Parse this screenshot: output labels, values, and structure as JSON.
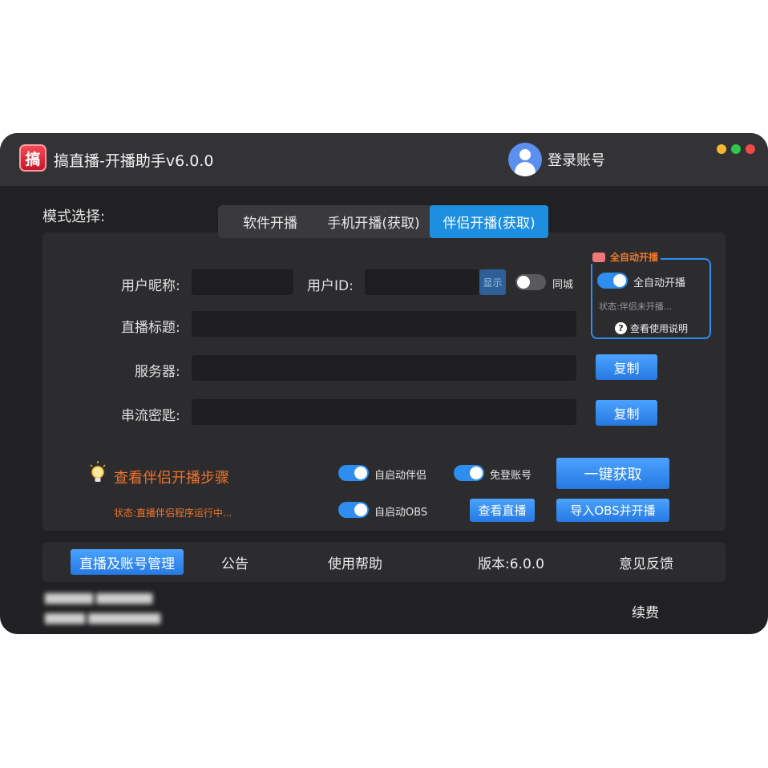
{
  "app": {
    "logo_char": "搞",
    "title": "搞直播-开播助手v6.0.0",
    "login_label": "登录账号",
    "window_dots": [
      "#f5b82e",
      "#2fc84a",
      "#ee4a4a"
    ]
  },
  "mode": {
    "label": "模式选择:",
    "tabs": [
      {
        "label": "软件开播",
        "active": false
      },
      {
        "label": "手机开播(获取)",
        "active": false
      },
      {
        "label": "伴侣开播(获取)",
        "active": true
      }
    ]
  },
  "form": {
    "nickname_label": "用户昵称:",
    "nickname_value": "",
    "userid_label": "用户ID:",
    "userid_value": "",
    "show_button": "显示",
    "same_city_label": "同城",
    "same_city_on": false,
    "title_label": "直播标题:",
    "title_value": "",
    "server_label": "服务器:",
    "server_value": "",
    "key_label": "串流密匙:",
    "key_value": "",
    "copy_label": "复制"
  },
  "auto_start": {
    "title": "全自动开播",
    "toggle_label": "全自动开播",
    "toggle_on": true,
    "status": "状态:伴侣未开播...",
    "help_label": "查看使用说明"
  },
  "actions": {
    "steps_link": "查看伴侣开播步骤",
    "status": "状态:直播伴侣程序运行中...",
    "auto_companion_label": "自启动伴侣",
    "auto_companion_on": true,
    "no_login_label": "免登账号",
    "no_login_on": true,
    "auto_obs_label": "自启动OBS",
    "auto_obs_on": true,
    "one_click": "一键获取",
    "view_live": "查看直播",
    "import_obs": "导入OBS并开播"
  },
  "bottom_nav": {
    "active": "直播及账号管理",
    "notice": "公告",
    "help": "使用帮助",
    "version": "版本:6.0.0",
    "feedback": "意见反馈"
  },
  "footer": {
    "renew": "续费"
  },
  "colors": {
    "accent": "#1d8fe1",
    "warning_text": "#f0732a",
    "window_bg": "#212123"
  }
}
